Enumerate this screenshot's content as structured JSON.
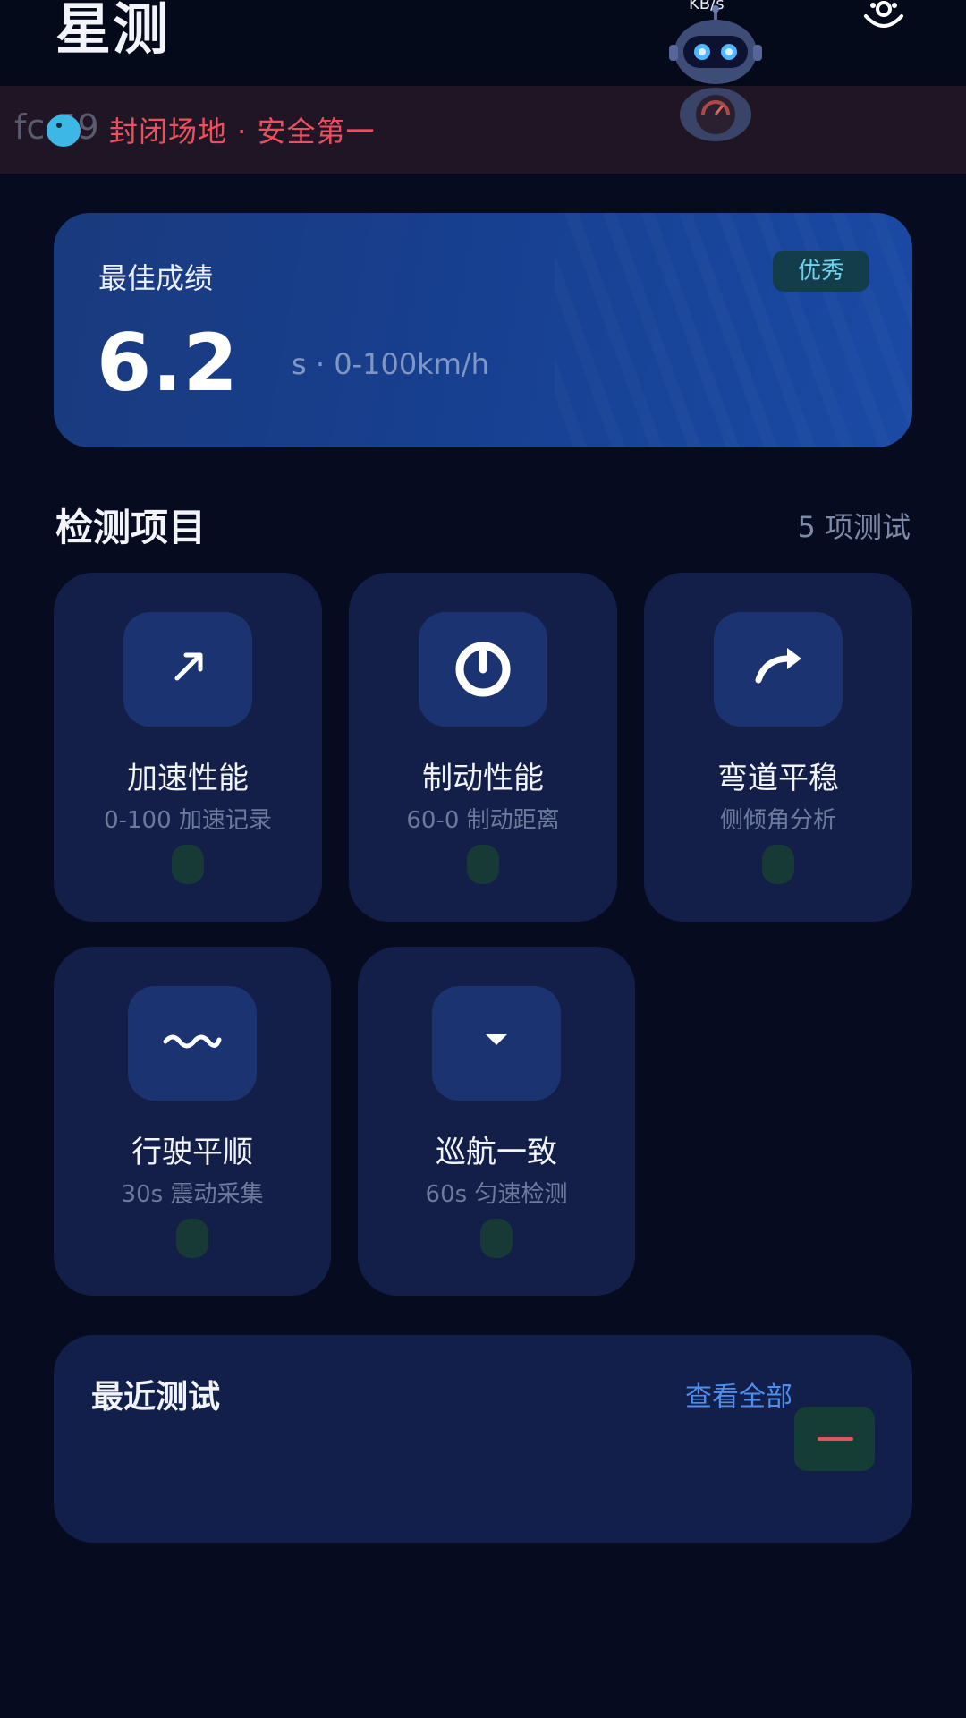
{
  "header": {
    "app_title": "星测",
    "status_partial": "KB/s"
  },
  "banner": {
    "ghost_text": "fc  59",
    "text": "封闭场地 · 安全第一"
  },
  "best": {
    "label": "最佳成绩",
    "badge": "优秀",
    "value": "6.2",
    "unit": "s · 0-100km/h"
  },
  "section": {
    "title": "检测项目",
    "count": "5 项测试"
  },
  "tests": [
    {
      "title": "加速性能",
      "subtitle": "0-100 加速记录",
      "icon": "arrow-up-right-icon"
    },
    {
      "title": "制动性能",
      "subtitle": "60-0 制动距离",
      "icon": "power-icon"
    },
    {
      "title": "弯道平稳",
      "subtitle": "侧倾角分析",
      "icon": "curve-arrow-icon"
    },
    {
      "title": "行驶平顺",
      "subtitle": "30s 震动采集",
      "icon": "wave-icon"
    },
    {
      "title": "巡航一致",
      "subtitle": "60s 匀速检测",
      "icon": "caret-down-icon"
    }
  ],
  "recent": {
    "title": "最近测试",
    "view_all": "查看全部"
  },
  "colors": {
    "background": "#060b1f",
    "card": "#131f48",
    "accent_blue": "#4b8ff0",
    "alert_red": "#ef4f5c",
    "badge_cyan": "#6dd3ee"
  }
}
